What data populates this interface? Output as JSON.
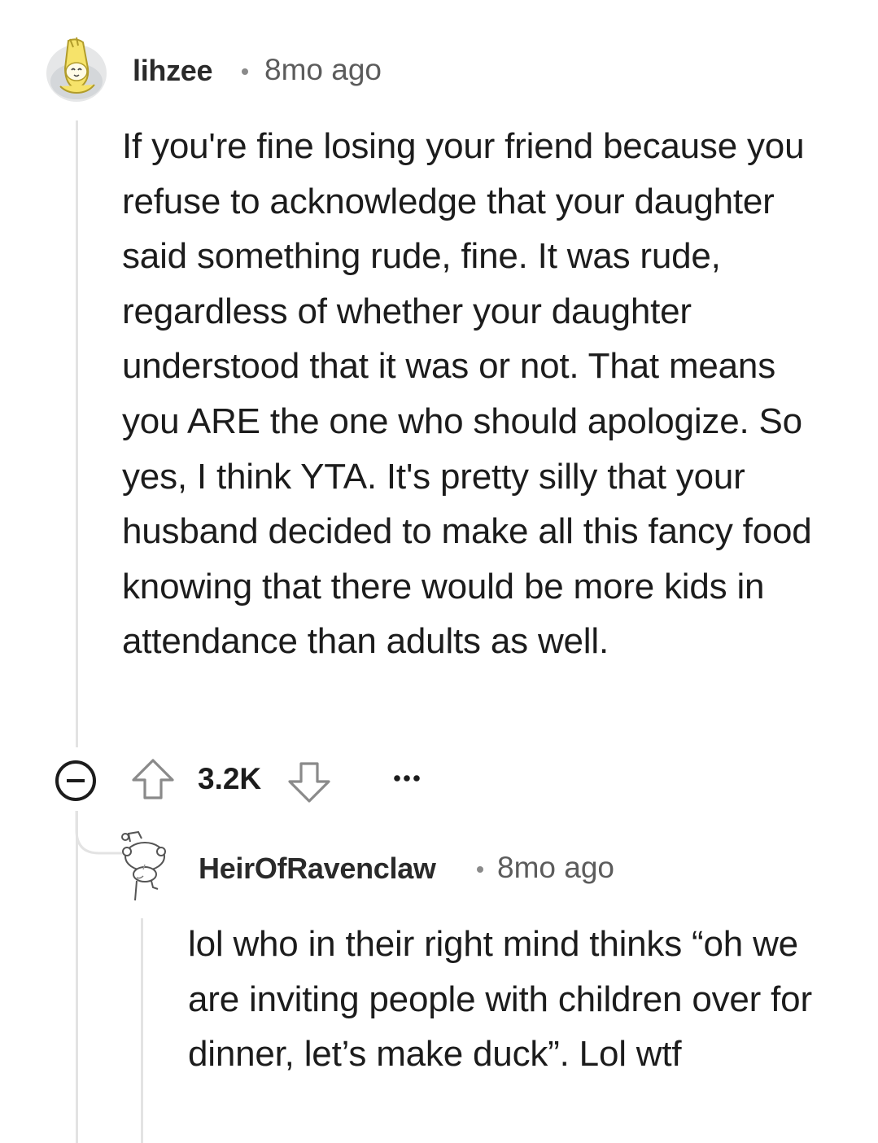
{
  "comments": [
    {
      "username": "lihzee",
      "timestamp": "8mo ago",
      "avatar": "banana-avatar-icon",
      "body": "If you're fine losing your friend because you refuse to acknowledge that your daughter said something rude, fine. It was rude, regardless of whether your daughter understood that it was or not. That means you ARE the one who should apologize. So yes, I think YTA. It's pretty silly that your husband decided to make all this fancy food knowing that there would be more kids in attendance than adults as well.",
      "score": "3.2K"
    },
    {
      "username": "HeirOfRavenclaw",
      "timestamp": "8mo ago",
      "avatar": "snoo-avatar-icon",
      "body": "lol who in their right mind thinks “oh we are inviting people with children over for dinner, let’s make duck”. Lol wtf"
    }
  ],
  "icons": {
    "collapse": "collapse-minus-icon",
    "upvote": "upvote-arrow-icon",
    "downvote": "downvote-arrow-icon",
    "more": "more-options-icon"
  },
  "colors": {
    "text": "#1c1c1c",
    "meta": "#5c5c5c",
    "thread_line": "#e3e3e3",
    "avatar_bg": "#e9e9e9",
    "banana": "#f5e46a"
  }
}
